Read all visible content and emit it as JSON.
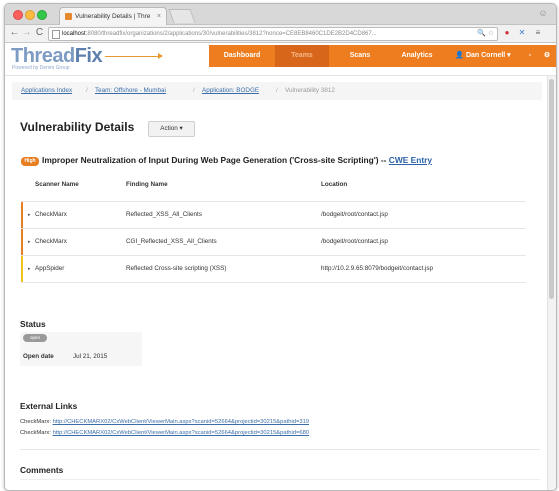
{
  "browser": {
    "tab_title": "Vulnerability Details | Thre",
    "tab_close": "×",
    "url_host": "localhost",
    "url_rest": ":8080/threadfix/organizations/2/applications/30/vulnerabilities/3812?nonce=CE8EB8460C1DE2B2D4CD867...",
    "icons": {
      "back": "arrow-left-icon",
      "forward": "arrow-right-icon",
      "reload": "reload-icon",
      "star": "star-icon",
      "profile": "person-icon",
      "menu": "hamburger-icon"
    }
  },
  "app": {
    "logo_thread": "Thread",
    "logo_fix": "Fix",
    "logo_tagline": "Powered by Denim Group",
    "nav": {
      "dashboard": "Dashboard",
      "teams": "Teams",
      "scans": "Scans",
      "analytics": "Analytics",
      "user": "👤 Dan Cornell ▾"
    }
  },
  "breadcrumb": {
    "applications_index": "Applications Index",
    "team": "Team: Offshore - Mumbai",
    "application": "Application: BODGE",
    "current": "Vulnerability 3812",
    "separator": "/"
  },
  "vulnerability": {
    "page_title": "Vulnerability Details",
    "action_label": "Action ▾",
    "severity": "High",
    "title": "Improper Neutralization of Input During Web Page Generation ('Cross-site Scripting') --",
    "cwe_link": "CWE Entry"
  },
  "findings": {
    "headers": [
      "Scanner Name",
      "Finding Name",
      "Location"
    ],
    "rows": [
      {
        "scanner": "CheckMarx",
        "finding": "Reflected_XSS_All_Clients",
        "location": "/bodgeit/root/contact.jsp",
        "color": "#e77e22"
      },
      {
        "scanner": "CheckMarx",
        "finding": "CGI_Reflected_XSS_All_Clients",
        "location": "/bodgeit/root/contact.jsp",
        "color": "#e77e22"
      },
      {
        "scanner": "AppSpider",
        "finding": "Reflected Cross-site scripting (XSS)",
        "location": "http://10.2.9.65:8079/bodgeit/contact.jsp",
        "color": "#f2c21b"
      }
    ]
  },
  "status": {
    "heading": "Status",
    "pill": "open",
    "open_date_label": "Open date",
    "open_date": "Jul 21, 2015"
  },
  "external_links": {
    "heading": "External Links",
    "items": [
      {
        "prefix": "CheckMarx:",
        "url": "http://CHECKMARX02/CxWebClient/ViewerMain.aspx?scanid=52664&projectid=30215&pathid=319"
      },
      {
        "prefix": "CheckMarx:",
        "url": "http://CHECKMARX02/CxWebClient/ViewerMain.aspx?scanid=52664&projectid=30215&pathid=680"
      }
    ]
  },
  "comments": {
    "heading": "Comments"
  }
}
